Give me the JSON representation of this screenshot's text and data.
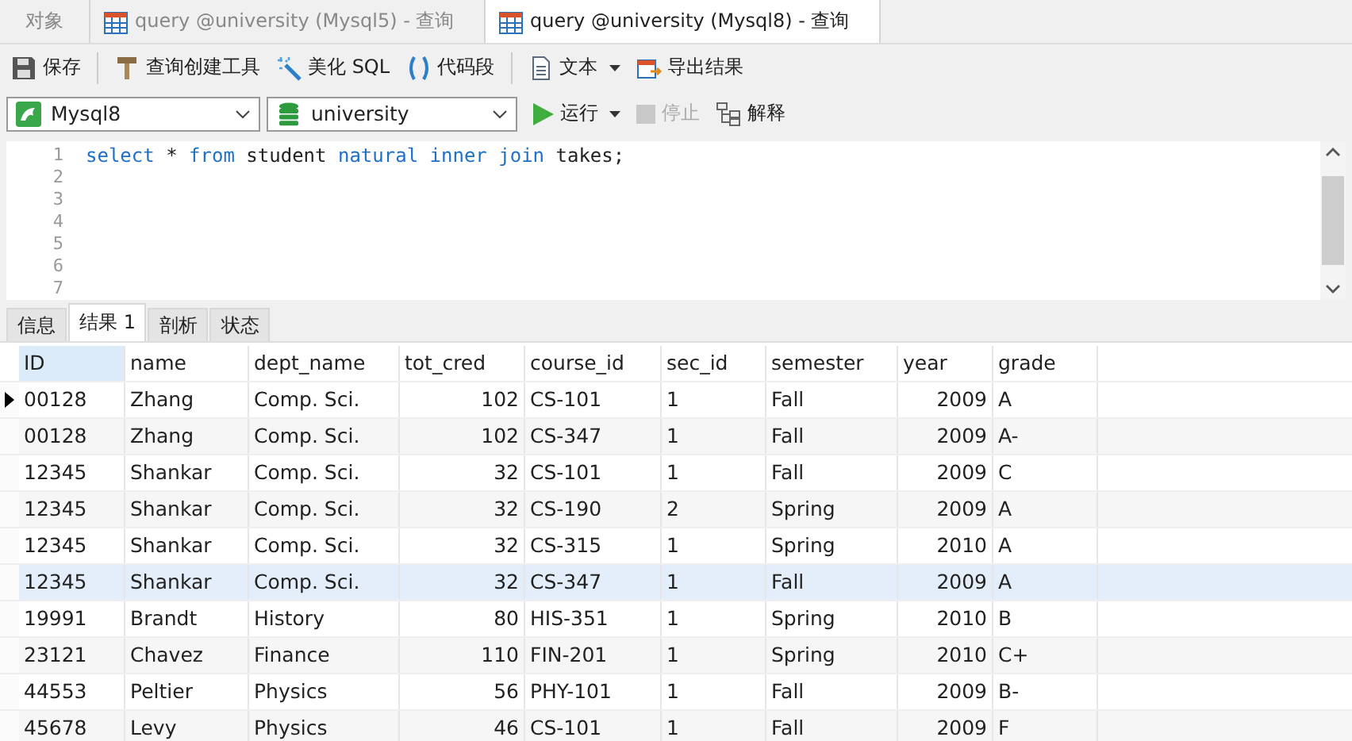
{
  "window_tabs": [
    {
      "label": "对象",
      "kind": "objects",
      "selected": false
    },
    {
      "label": "query @university (Mysql5) - 查询",
      "kind": "query",
      "selected": false
    },
    {
      "label": "query @university (Mysql8) - 查询",
      "kind": "query",
      "selected": true
    }
  ],
  "toolbar": [
    {
      "label": "保存",
      "kind": "save",
      "disabled": false
    },
    {
      "kind": "separator"
    },
    {
      "label": "查询创建工具",
      "kind": "builder",
      "disabled": false
    },
    {
      "label": "美化 SQL",
      "kind": "beautify",
      "disabled": false
    },
    {
      "label": "代码段",
      "kind": "snippet",
      "disabled": false
    },
    {
      "kind": "separator"
    },
    {
      "label": "文本",
      "kind": "text",
      "disabled": false,
      "dropdown": true
    },
    {
      "label": "导出结果",
      "kind": "export",
      "disabled": false
    }
  ],
  "connection": {
    "value": "Mysql8"
  },
  "database": {
    "value": "university"
  },
  "run_bar": [
    {
      "label": "运行",
      "kind": "run",
      "disabled": false,
      "dropdown": true
    },
    {
      "label": "停止",
      "kind": "stop",
      "disabled": true
    },
    {
      "label": "解释",
      "kind": "explain",
      "disabled": false
    }
  ],
  "editor": {
    "line_numbers": [
      "1",
      "2",
      "3",
      "4",
      "5",
      "6",
      "7"
    ],
    "lines": [
      [
        {
          "text": "select",
          "kind": "keyword"
        },
        {
          "text": " * ",
          "kind": "plain"
        },
        {
          "text": "from",
          "kind": "keyword"
        },
        {
          "text": " student ",
          "kind": "plain"
        },
        {
          "text": "natural inner join",
          "kind": "keyword"
        },
        {
          "text": " takes;",
          "kind": "plain"
        }
      ]
    ]
  },
  "result_tabs": [
    {
      "label": "信息",
      "selected": false
    },
    {
      "label": "结果 1",
      "selected": true
    },
    {
      "label": "剖析",
      "selected": false
    },
    {
      "label": "状态",
      "selected": false
    }
  ],
  "table": {
    "columns": [
      {
        "label": "ID",
        "selected": true,
        "numeric": false
      },
      {
        "label": "name",
        "selected": false,
        "numeric": false
      },
      {
        "label": "dept_name",
        "selected": false,
        "numeric": false
      },
      {
        "label": "tot_cred",
        "selected": false,
        "numeric": true
      },
      {
        "label": "course_id",
        "selected": false,
        "numeric": false
      },
      {
        "label": "sec_id",
        "selected": false,
        "numeric": false
      },
      {
        "label": "semester",
        "selected": false,
        "numeric": false
      },
      {
        "label": "year",
        "selected": false,
        "numeric": true
      },
      {
        "label": "grade",
        "selected": false,
        "numeric": false
      }
    ],
    "rows": [
      {
        "current": true,
        "selected": false,
        "cells": [
          "00128",
          "Zhang",
          "Comp. Sci.",
          "102",
          "CS-101",
          "1",
          "Fall",
          "2009",
          "A"
        ]
      },
      {
        "current": false,
        "selected": false,
        "cells": [
          "00128",
          "Zhang",
          "Comp. Sci.",
          "102",
          "CS-347",
          "1",
          "Fall",
          "2009",
          "A-"
        ]
      },
      {
        "current": false,
        "selected": false,
        "cells": [
          "12345",
          "Shankar",
          "Comp. Sci.",
          "32",
          "CS-101",
          "1",
          "Fall",
          "2009",
          "C"
        ]
      },
      {
        "current": false,
        "selected": false,
        "cells": [
          "12345",
          "Shankar",
          "Comp. Sci.",
          "32",
          "CS-190",
          "2",
          "Spring",
          "2009",
          "A"
        ]
      },
      {
        "current": false,
        "selected": false,
        "cells": [
          "12345",
          "Shankar",
          "Comp. Sci.",
          "32",
          "CS-315",
          "1",
          "Spring",
          "2010",
          "A"
        ]
      },
      {
        "current": false,
        "selected": true,
        "cells": [
          "12345",
          "Shankar",
          "Comp. Sci.",
          "32",
          "CS-347",
          "1",
          "Fall",
          "2009",
          "A"
        ]
      },
      {
        "current": false,
        "selected": false,
        "cells": [
          "19991",
          "Brandt",
          "History",
          "80",
          "HIS-351",
          "1",
          "Spring",
          "2010",
          "B"
        ]
      },
      {
        "current": false,
        "selected": false,
        "cells": [
          "23121",
          "Chavez",
          "Finance",
          "110",
          "FIN-201",
          "1",
          "Spring",
          "2010",
          "C+"
        ]
      },
      {
        "current": false,
        "selected": false,
        "cells": [
          "44553",
          "Peltier",
          "Physics",
          "56",
          "PHY-101",
          "1",
          "Fall",
          "2009",
          "B-"
        ]
      },
      {
        "current": false,
        "selected": false,
        "cells": [
          "45678",
          "Levy",
          "Physics",
          "46",
          "CS-101",
          "1",
          "Fall",
          "2009",
          "F"
        ]
      }
    ]
  }
}
